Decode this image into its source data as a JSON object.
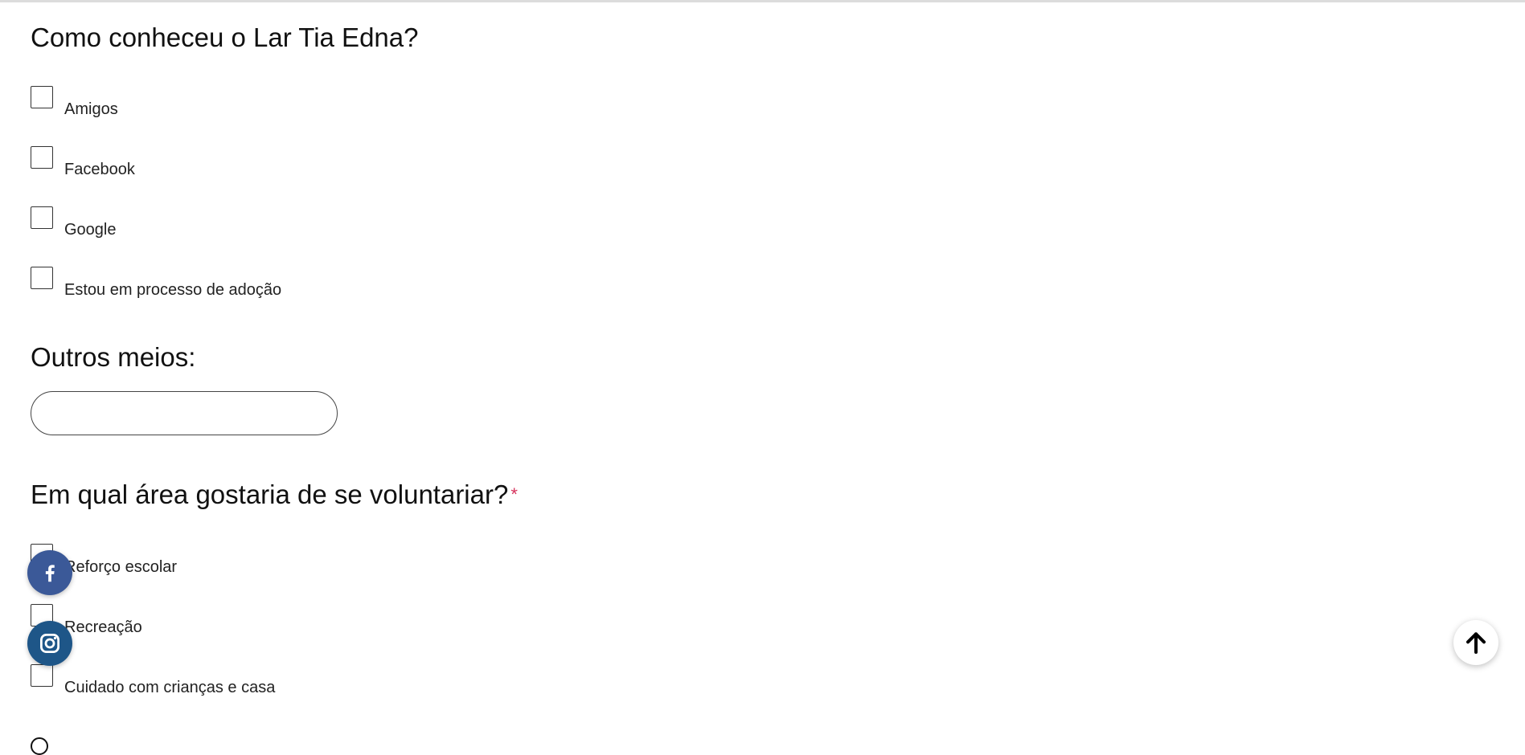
{
  "section_how": {
    "title": "Como conheceu o Lar Tia Edna?",
    "options": [
      "Amigos",
      "Facebook",
      "Google",
      "Estou em processo de adoção"
    ]
  },
  "section_other": {
    "title": "Outros meios:",
    "input_value": "",
    "input_placeholder": ""
  },
  "section_area": {
    "title": "Em qual área gostaria de se voluntariar?",
    "required_mark": "*",
    "options": [
      "Reforço escolar",
      "Recreação",
      "Cuidado com crianças e casa"
    ]
  },
  "floating": {
    "facebook_icon": "facebook-icon",
    "instagram_icon": "instagram-icon",
    "scroll_top_icon": "arrow-up-icon"
  },
  "colors": {
    "facebook": "#3b5998",
    "instagram": "#1e5688",
    "required": "#d6335c"
  }
}
